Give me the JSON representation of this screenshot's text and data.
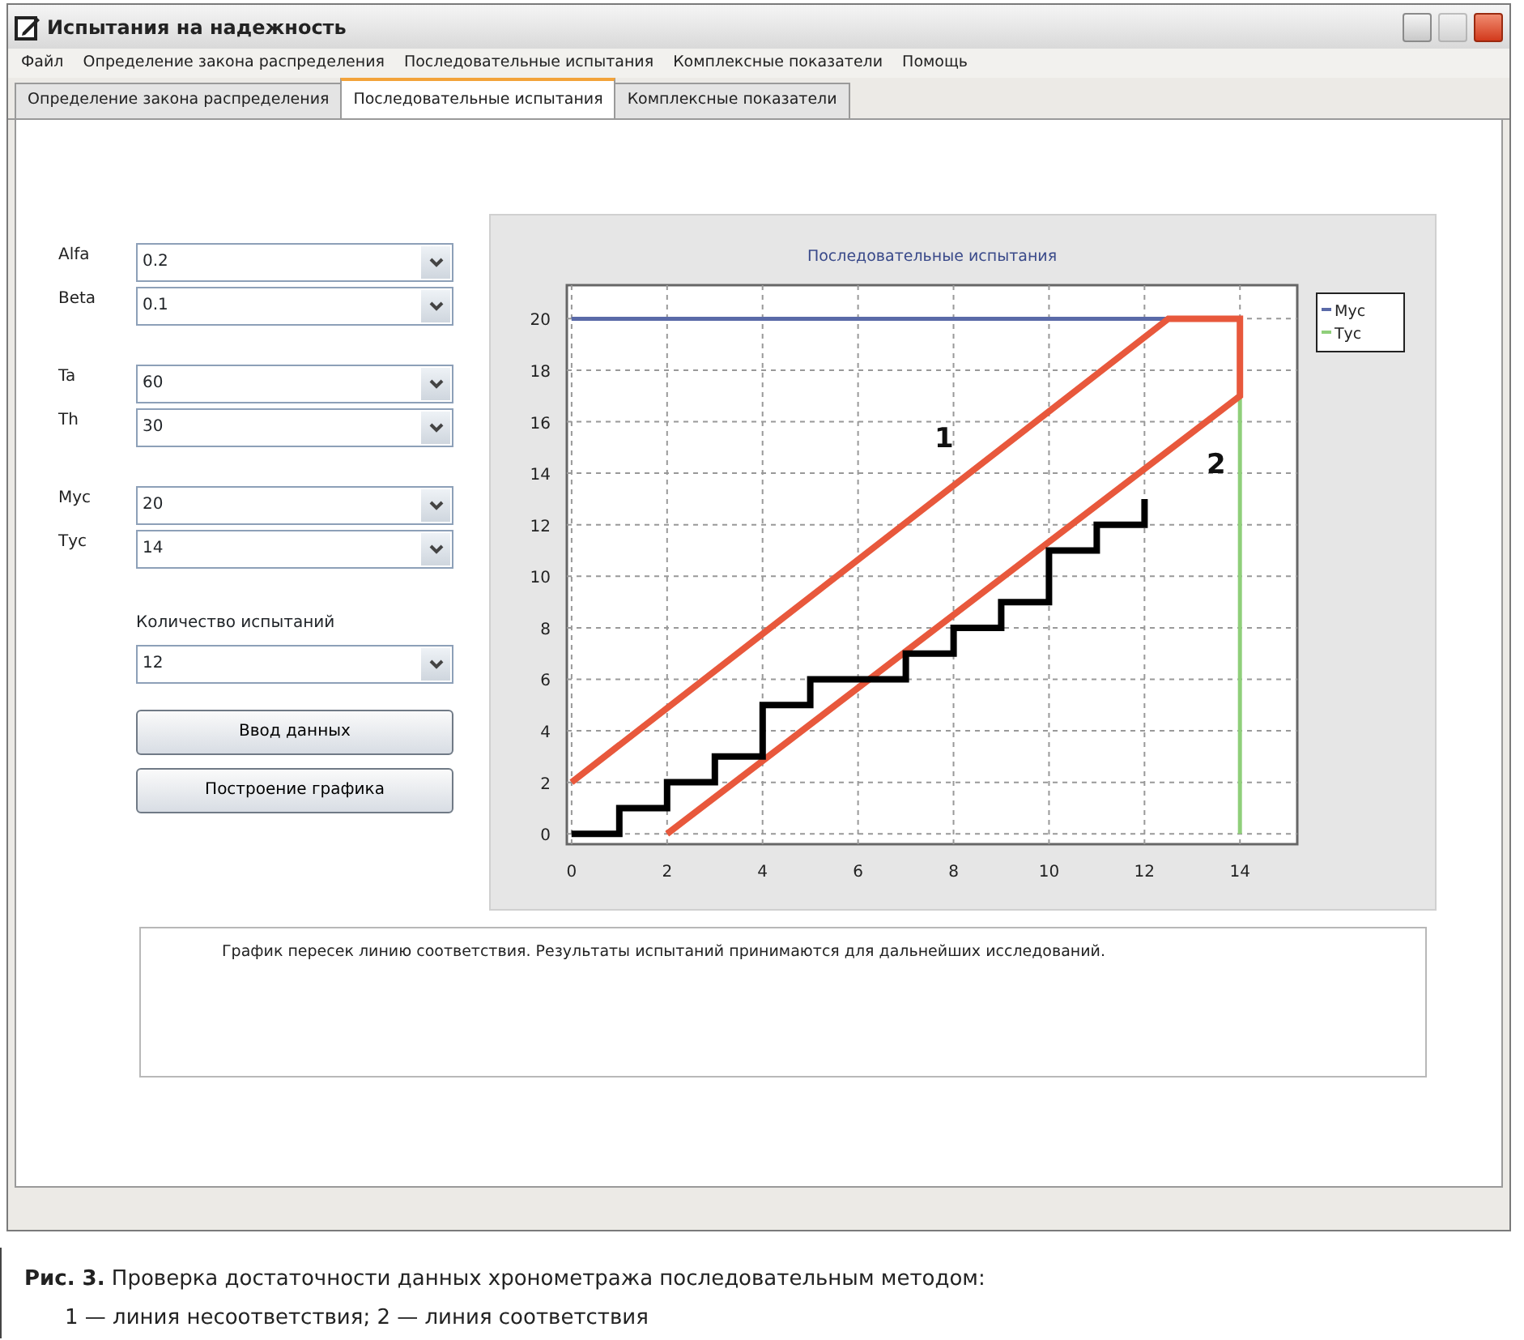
{
  "window": {
    "title": "Испытания на надежность"
  },
  "menu": [
    "Файл",
    "Определение закона распределения",
    "Последовательные испытания",
    "Комплексные показатели",
    "Помощь"
  ],
  "tabs": [
    {
      "label": "Определение закона распределения",
      "selected": false
    },
    {
      "label": "Последовательные испытания",
      "selected": true
    },
    {
      "label": "Комплексные показатели",
      "selected": false
    }
  ],
  "parameter_groups": [
    [
      {
        "label": "Alfa",
        "value": "0.2"
      },
      {
        "label": "Beta",
        "value": "0.1"
      }
    ],
    [
      {
        "label": "Ta",
        "value": "60"
      },
      {
        "label": "Th",
        "value": "30"
      }
    ],
    [
      {
        "label": "Мус",
        "value": "20"
      },
      {
        "label": "Тус",
        "value": "14"
      }
    ]
  ],
  "trials": {
    "label": "Количество испытаний",
    "value": "12"
  },
  "buttons": [
    "Ввод данных",
    "Построение графика"
  ],
  "chart": {
    "chart_data": {
      "type": "line",
      "title": "Последовательные испытания",
      "xlim": [
        -0.1,
        15.2
      ],
      "ylim": [
        -0.4,
        21.3
      ],
      "xticks": [
        0,
        2,
        4,
        6,
        8,
        10,
        12,
        14
      ],
      "yticks": [
        0,
        2,
        4,
        6,
        8,
        10,
        12,
        14,
        16,
        18,
        20
      ],
      "series": [
        {
          "name": "Мус",
          "color": "#5a6aa8",
          "x": [
            0,
            12.5
          ],
          "values": [
            20,
            20
          ]
        },
        {
          "name": "Тус",
          "color": "#8fcf7a",
          "x": [
            14,
            14
          ],
          "values": [
            0,
            17
          ]
        },
        {
          "color": "#e8583c",
          "x": [
            0,
            12.5,
            14,
            14,
            2
          ],
          "values": [
            2,
            20,
            20,
            17,
            0
          ]
        },
        {
          "color": "#000000",
          "x": [
            0,
            1,
            1,
            2,
            2,
            3,
            3,
            4,
            4,
            5,
            5,
            7,
            7,
            8,
            8,
            9,
            9,
            10,
            10,
            11,
            11,
            12,
            12
          ],
          "values": [
            0,
            0,
            1,
            1,
            2,
            2,
            3,
            3,
            5,
            5,
            6,
            6,
            7,
            7,
            8,
            8,
            9,
            9,
            11,
            11,
            12,
            12,
            13
          ]
        }
      ],
      "grid": true,
      "legend": "right",
      "annotations": [
        "1",
        "2"
      ]
    }
  },
  "message": "График пересек линию соответствия. Результаты испытаний принимаются для дальнейших исследований.",
  "caption": [
    "**Рис. 3.** Проверка достаточности данных хронометража последовательным методом:",
    "1 — линия несоответствия; 2 — линия соответствия"
  ]
}
